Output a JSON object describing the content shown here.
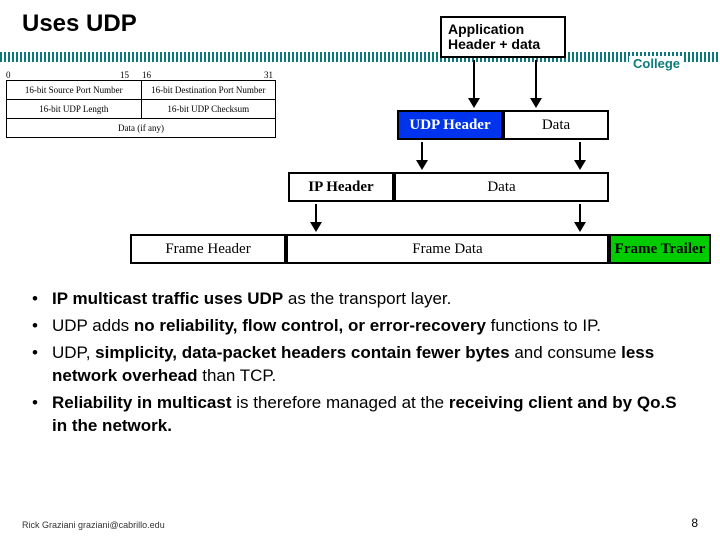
{
  "title": "Uses UDP",
  "college": "College",
  "app_box": "Application Header + data",
  "udp": {
    "header": "UDP Header",
    "data": "Data"
  },
  "ip": {
    "header": "IP Header",
    "data": "Data"
  },
  "frame": {
    "header": "Frame Header",
    "data": "Frame Data",
    "trailer": "Frame Trailer"
  },
  "udp_fields": {
    "bits": {
      "b0": "0",
      "b15": "15",
      "b16": "16",
      "b31": "31"
    },
    "r1c1": "16-bit Source Port Number",
    "r1c2": "16-bit Destination Port Number",
    "r2c1": "16-bit UDP Length",
    "r2c2": "16-bit UDP Checksum",
    "data": "Data (if any)"
  },
  "bullets": {
    "b1_a": "IP multicast traffic uses UDP",
    "b1_b": " as the transport layer.",
    "b2_a": "UDP adds ",
    "b2_b": "no reliability, flow control, or error-recovery",
    "b2_c": " functions to IP.",
    "b3_a": "UDP, ",
    "b3_b": "simplicity, data-packet headers contain fewer bytes",
    "b3_c": " and consume ",
    "b3_d": "less network overhead",
    "b3_e": " than TCP.",
    "b4_a": "Reliability in multicast",
    "b4_b": " is therefore managed at the ",
    "b4_c": "receiving client and by Qo.S in the network."
  },
  "footer": {
    "left": "Rick Graziani  graziani@cabrillo.edu",
    "page": "8"
  }
}
